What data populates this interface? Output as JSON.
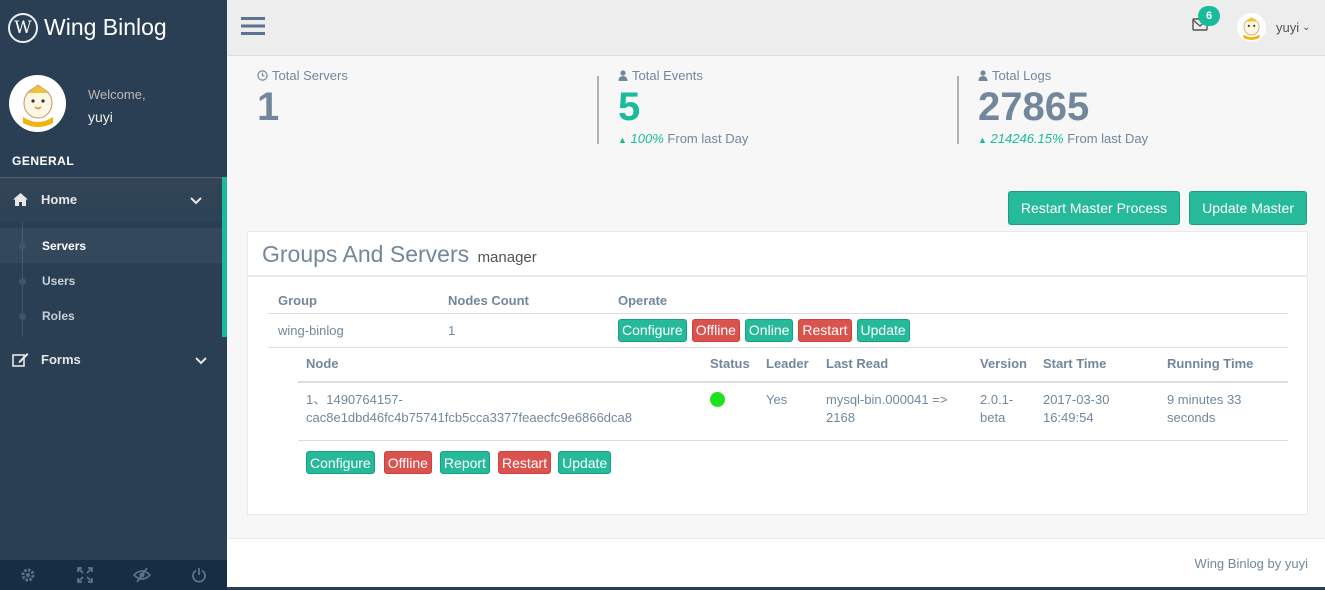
{
  "brand": {
    "logo_letter": "W",
    "name": "Wing Binlog"
  },
  "profile": {
    "welcome": "Welcome,",
    "username": "yuyi"
  },
  "sidebar": {
    "section_title": "GENERAL",
    "home_label": "Home",
    "sub_items": [
      {
        "label": "Servers"
      },
      {
        "label": "Users"
      },
      {
        "label": "Roles"
      }
    ],
    "forms_label": "Forms",
    "footer_icons": [
      "gear-icon",
      "fullscreen-icon",
      "eye-slash-icon",
      "power-icon"
    ]
  },
  "topnav": {
    "mail_badge": "6",
    "username": "yuyi",
    "chevron": "⌄"
  },
  "stats": {
    "servers": {
      "label": "Total Servers",
      "count": "1"
    },
    "events": {
      "label": "Total Events",
      "count": "5",
      "pct": "100%",
      "suffix": "From last Day"
    },
    "logs": {
      "label": "Total Logs",
      "count": "27865",
      "pct": "214246.15%",
      "suffix": "From last Day"
    }
  },
  "actions": {
    "restart_master": "Restart Master Process",
    "update_master": "Update Master"
  },
  "panel": {
    "title": "Groups And Servers",
    "subtitle": "manager",
    "groups_headers": {
      "group": "Group",
      "nodes_count": "Nodes Count",
      "operate": "Operate"
    },
    "group_row": {
      "group": "wing-binlog",
      "nodes_count": "1",
      "buttons": {
        "configure": "Configure",
        "offline": "Offline",
        "online": "Online",
        "restart": "Restart",
        "update": "Update"
      }
    },
    "nodes_headers": {
      "node": "Node",
      "status": "Status",
      "leader": "Leader",
      "last_read": "Last Read",
      "version": "Version",
      "start_time": "Start Time",
      "running_time": "Running Time"
    },
    "node_row": {
      "node_line1": "1、1490764157-",
      "node_line2": "cac8e1dbd46fc4b75741fcb5cca3377feaecfc9e6866dca8",
      "status_color": "#1FE21F",
      "leader": "Yes",
      "last_read_line1": "mysql-bin.000041 =>",
      "last_read_line2": "2168",
      "version_line1": "2.0.1-",
      "version_line2": "beta",
      "start_time_line1": "2017-03-30",
      "start_time_line2": "16:49:54",
      "running_time_line1": "9 minutes 33",
      "running_time_line2": "seconds"
    },
    "node_buttons": {
      "configure": "Configure",
      "offline": "Offline",
      "report": "Report",
      "restart": "Restart",
      "update": "Update"
    }
  },
  "footer": {
    "text": "Wing Binlog by yuyi"
  },
  "colors": {
    "accent": "#1ABB9C",
    "success": "#26B99A",
    "danger": "#D9534F",
    "sidebar": "#2A3F54",
    "text": "#73879C"
  }
}
